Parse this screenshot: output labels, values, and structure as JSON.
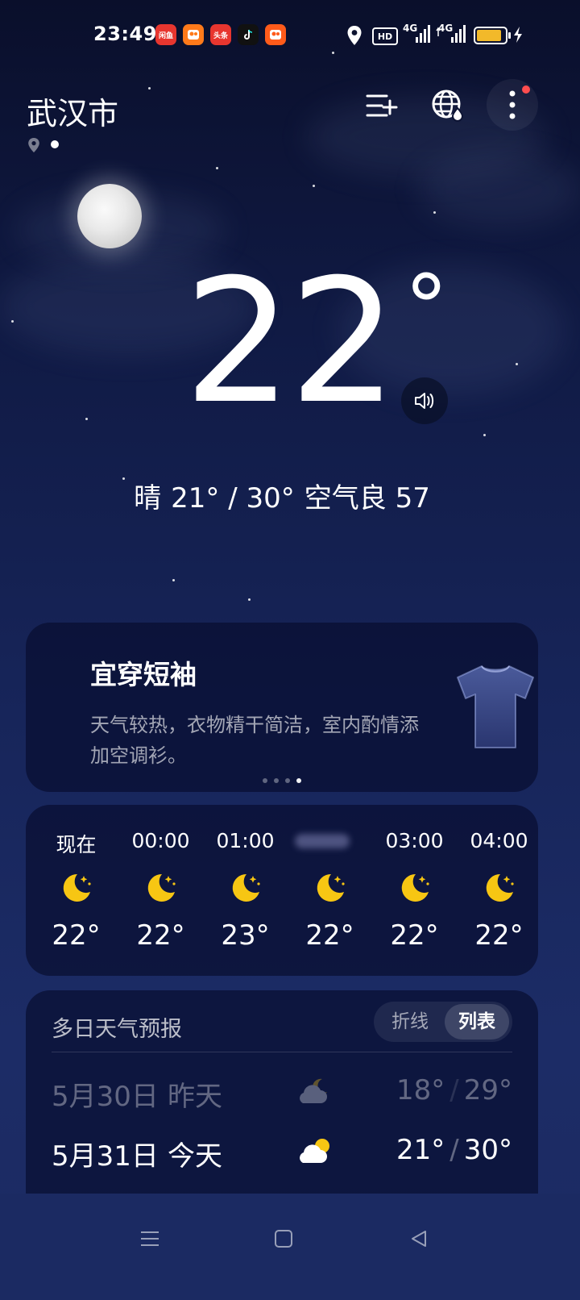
{
  "status_bar": {
    "time": "23:49",
    "apps": [
      "闲鱼",
      "快手极速版",
      "头条",
      "抖音极速版",
      "快手"
    ],
    "network": "4G",
    "network2": "4G",
    "hd": "HD",
    "battery_level": 0.85
  },
  "header": {
    "city": "武汉市",
    "add_city_icon": "add-city-icon",
    "globe_icon": "globe-weather-icon",
    "more_icon": "more-icon",
    "accent_dot": "#ff4d4f"
  },
  "current": {
    "temp": "22",
    "degree": "°",
    "condition": "晴",
    "range": "21° / 30°",
    "air": "空气良 57"
  },
  "tip": {
    "title": "宜穿短袖",
    "desc": "天气较热，衣物精干简洁，室内酌情添加空调衫。",
    "pages": 4,
    "active_page": 4
  },
  "hourly": [
    {
      "time": "现在",
      "temp": "22°"
    },
    {
      "time": "00:00",
      "temp": "22°"
    },
    {
      "time": "01:00",
      "temp": "23°"
    },
    {
      "time": "",
      "temp": "22°"
    },
    {
      "time": "03:00",
      "temp": "22°"
    },
    {
      "time": "04:00",
      "temp": "22°"
    }
  ],
  "forecast": {
    "title": "多日天气预报",
    "toggle_line": "折线",
    "toggle_list": "列表",
    "days": [
      {
        "date": "5月30日",
        "day": "昨天",
        "low": "18°",
        "high": "29°",
        "icon": "partly-cloudy-night-icon"
      },
      {
        "date": "5月31日",
        "day": "今天",
        "low": "21°",
        "high": "30°",
        "icon": "partly-cloudy-day-icon"
      }
    ]
  },
  "colors": {
    "moon_icon": "#f7c613",
    "sun_icon": "#f7c613"
  }
}
